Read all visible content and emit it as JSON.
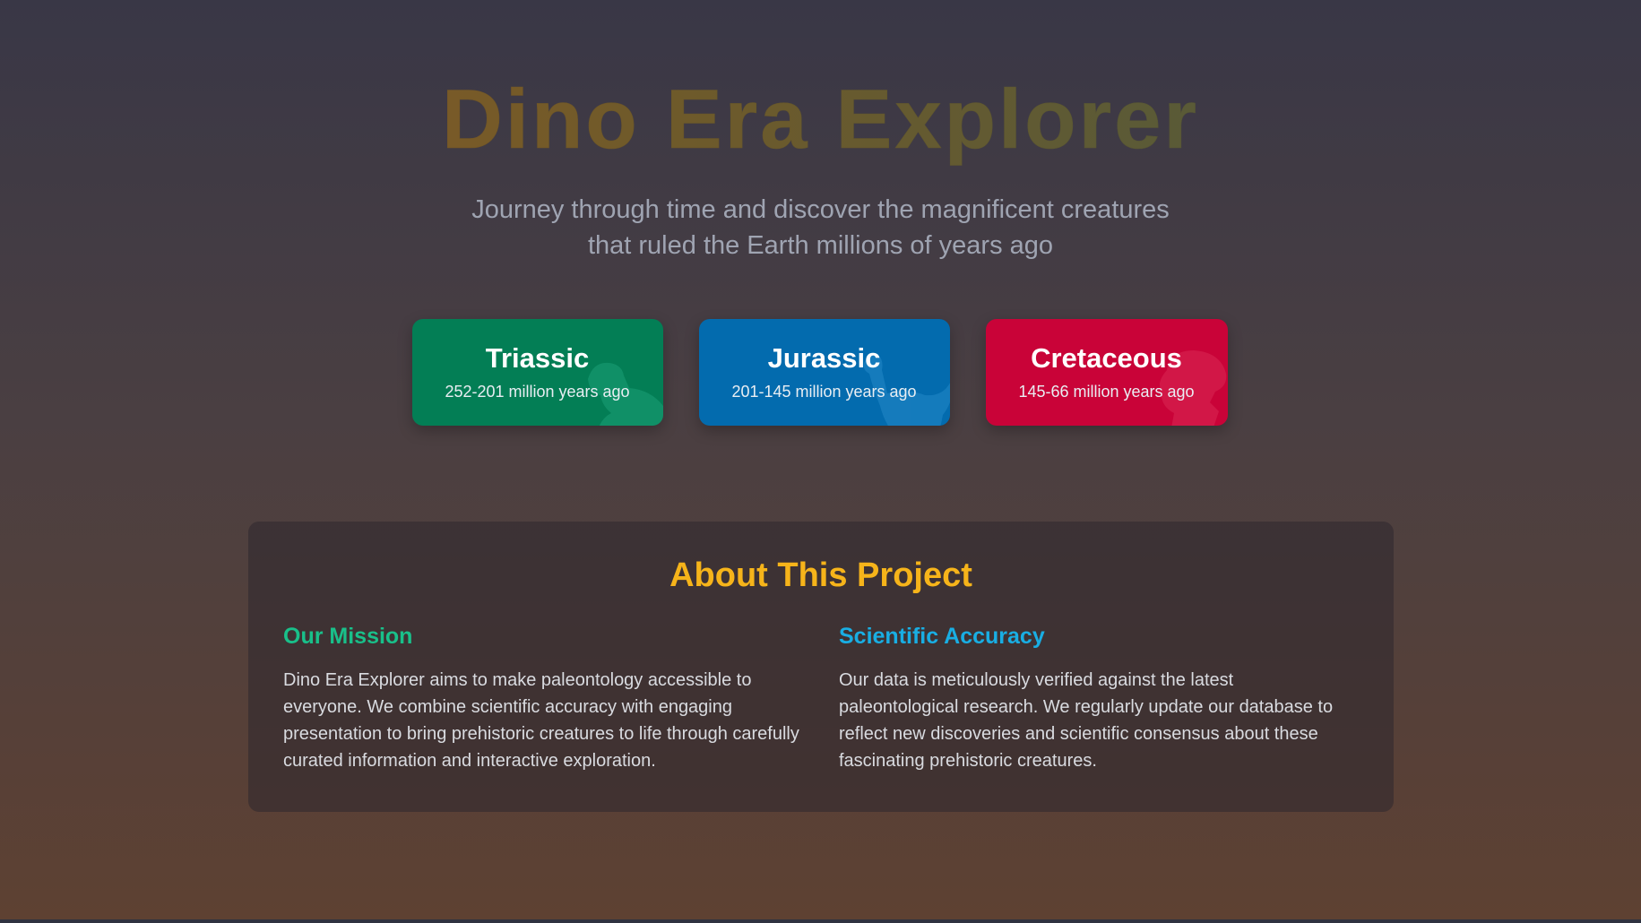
{
  "hero": {
    "title": "Dino Era Explorer",
    "subtitle_line1": "Journey through time and discover the magnificent creatures",
    "subtitle_line2": "that ruled the Earth millions of years ago"
  },
  "eras": [
    {
      "name": "Triassic",
      "range": "252-201 million years ago",
      "color": "#037e55",
      "icon": "dinosaur-silhouette-icon"
    },
    {
      "name": "Jurassic",
      "range": "201-145 million years ago",
      "color": "#036bae",
      "icon": "dinosaur-silhouette-icon"
    },
    {
      "name": "Cretaceous",
      "range": "145-66 million years ago",
      "color": "#c90338",
      "icon": "dinosaur-silhouette-icon"
    }
  ],
  "about": {
    "title": "About This Project",
    "mission": {
      "heading": "Our Mission",
      "text": "Dino Era Explorer aims to make paleontology accessible to everyone. We combine scientific accuracy with engaging presentation to bring prehistoric creatures to life through carefully curated information and interactive exploration."
    },
    "accuracy": {
      "heading": "Scientific Accuracy",
      "text": "Our data is meticulously verified against the latest paleontological research. We regularly update our database to reflect new discoveries and scientific consensus about these fascinating prehistoric creatures."
    }
  },
  "colors": {
    "about_title": "#f6b41a",
    "mission_heading": "#19c08a",
    "accuracy_heading": "#19aee3"
  }
}
